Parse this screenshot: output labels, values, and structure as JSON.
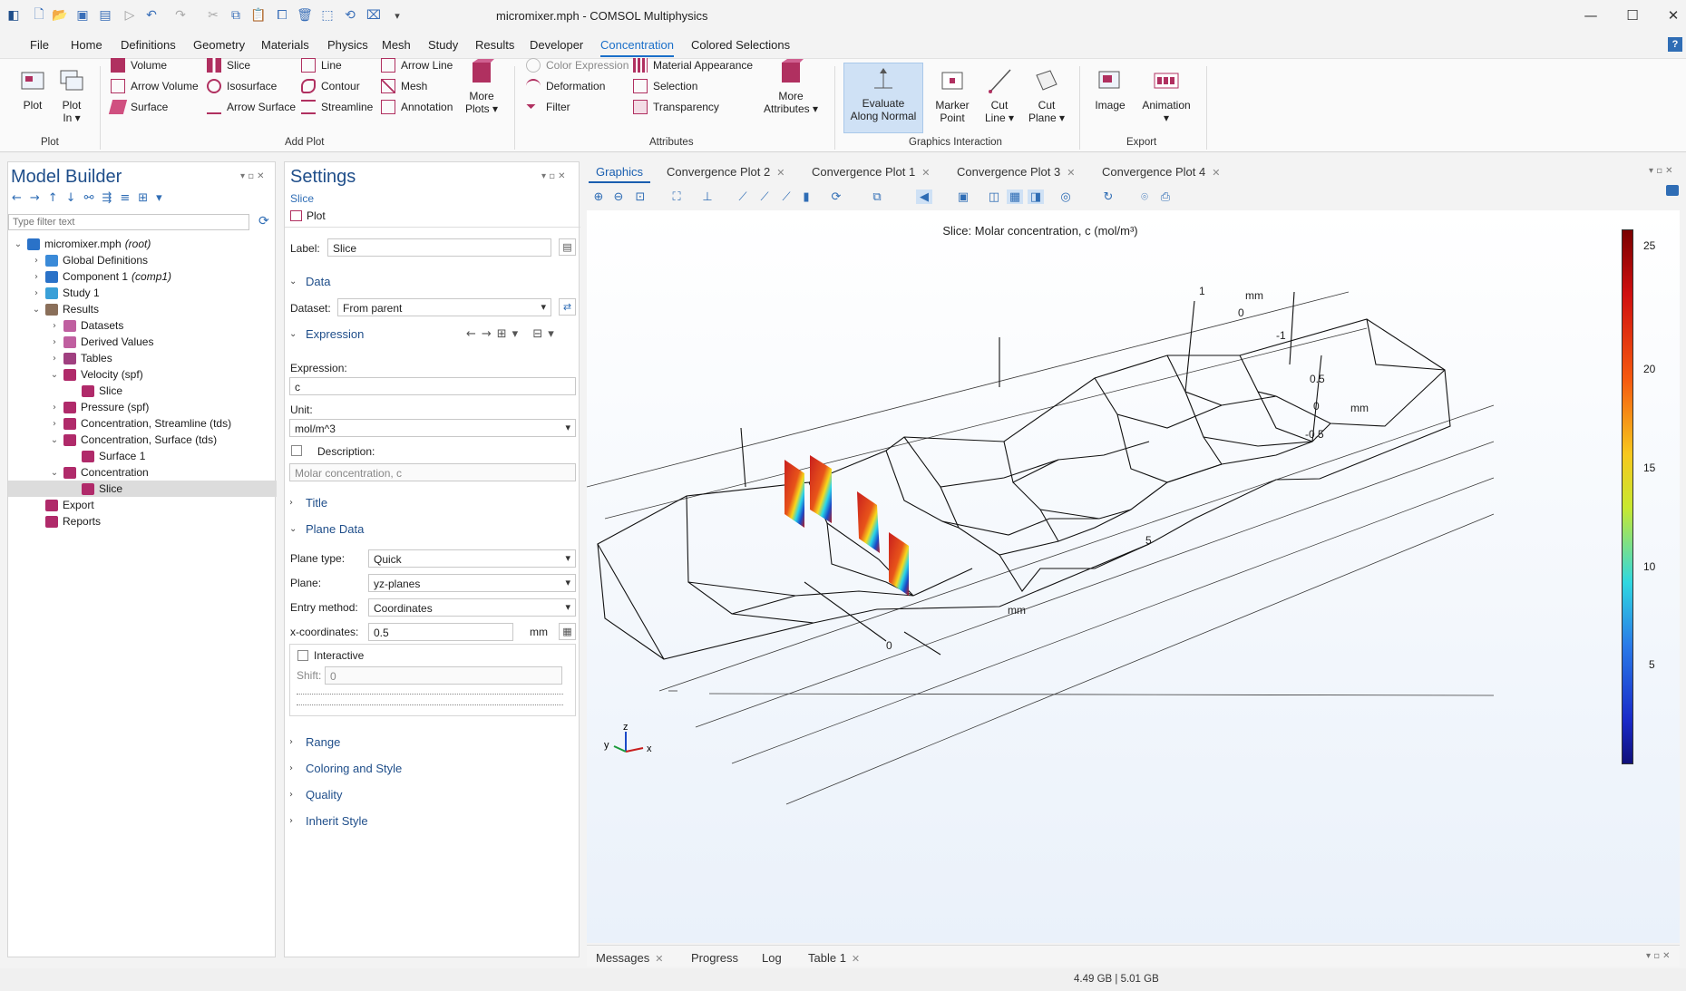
{
  "window": {
    "title": "micromixer.mph - COMSOL Multiphysics"
  },
  "menu": [
    "File",
    "Home",
    "Definitions",
    "Geometry",
    "Materials",
    "Physics",
    "Mesh",
    "Study",
    "Results",
    "Developer",
    "Concentration",
    "Colored Selections"
  ],
  "ribbon": {
    "plot": {
      "plot": "Plot",
      "plot_in": "Plot\nIn ▾",
      "group": "Plot"
    },
    "add_plot": {
      "volume": "Volume",
      "arrow_volume": "Arrow Volume",
      "surface": "Surface",
      "slice": "Slice",
      "isosurface": "Isosurface",
      "arrow_surface": "Arrow Surface",
      "line": "Line",
      "contour": "Contour",
      "streamline": "Streamline",
      "arrow_line": "Arrow Line",
      "mesh": "Mesh",
      "annotation": "Annotation",
      "more_plots": "More\nPlots ▾",
      "group": "Add Plot"
    },
    "attributes": {
      "color_expression": "Color Expression",
      "deformation": "Deformation",
      "filter": "Filter",
      "material_appearance": "Material Appearance",
      "selection": "Selection",
      "transparency": "Transparency",
      "more_attributes": "More\nAttributes ▾",
      "group": "Attributes"
    },
    "graphics_interaction": {
      "evaluate": "Evaluate\nAlong Normal",
      "marker": "Marker\nPoint",
      "cut_line": "Cut\nLine ▾",
      "cut_plane": "Cut\nPlane ▾",
      "group": "Graphics Interaction"
    },
    "export": {
      "image": "Image",
      "animation": "Animation\n▾",
      "group": "Export"
    }
  },
  "model_builder": {
    "title": "Model Builder",
    "filter_placeholder": "Type filter text",
    "tree": [
      {
        "label": "micromixer.mph",
        "suffix": "(root)",
        "level": 0,
        "exp": "v",
        "color": "#2a72c8"
      },
      {
        "label": "Global Definitions",
        "suffix": "",
        "level": 1,
        "exp": ">",
        "color": "#3a8ad8"
      },
      {
        "label": "Component 1",
        "suffix": "(comp1)",
        "level": 1,
        "exp": ">",
        "color": "#2a72c8"
      },
      {
        "label": "Study 1",
        "suffix": "",
        "level": 1,
        "exp": ">",
        "color": "#3aa0d8"
      },
      {
        "label": "Results",
        "suffix": "",
        "level": 1,
        "exp": "v",
        "color": "#8a6f5a"
      },
      {
        "label": "Datasets",
        "suffix": "",
        "level": 2,
        "exp": ">",
        "color": "#c05fa0"
      },
      {
        "label": "Derived Values",
        "suffix": "",
        "level": 2,
        "exp": ">",
        "color": "#c05fa0"
      },
      {
        "label": "Tables",
        "suffix": "",
        "level": 2,
        "exp": ">",
        "color": "#a04080"
      },
      {
        "label": "Velocity (spf)",
        "suffix": "",
        "level": 2,
        "exp": "v",
        "color": "#b02a6a"
      },
      {
        "label": "Slice",
        "suffix": "",
        "level": 3,
        "exp": "",
        "color": "#b02a6a"
      },
      {
        "label": "Pressure (spf)",
        "suffix": "",
        "level": 2,
        "exp": ">",
        "color": "#b02a6a"
      },
      {
        "label": "Concentration, Streamline (tds)",
        "suffix": "",
        "level": 2,
        "exp": ">",
        "color": "#b02a6a"
      },
      {
        "label": "Concentration, Surface (tds)",
        "suffix": "",
        "level": 2,
        "exp": "v",
        "color": "#b02a6a"
      },
      {
        "label": "Surface 1",
        "suffix": "",
        "level": 3,
        "exp": "",
        "color": "#b02a6a"
      },
      {
        "label": "Concentration",
        "suffix": "",
        "level": 2,
        "exp": "v",
        "color": "#b02a6a"
      },
      {
        "label": "Slice",
        "suffix": "",
        "level": 3,
        "exp": "",
        "color": "#b02a6a",
        "selected": true
      },
      {
        "label": "Export",
        "suffix": "",
        "level": 1,
        "exp": "",
        "color": "#b02a6a"
      },
      {
        "label": "Reports",
        "suffix": "",
        "level": 1,
        "exp": "",
        "color": "#b02a6a"
      }
    ]
  },
  "settings": {
    "title": "Settings",
    "subtitle": "Slice",
    "plot_btn": "Plot",
    "label_caption": "Label:",
    "label_value": "Slice",
    "sections": {
      "data": "Data",
      "expression": "Expression",
      "title": "Title",
      "plane_data": "Plane Data",
      "range": "Range",
      "coloring": "Coloring and Style",
      "quality": "Quality",
      "inherit": "Inherit Style"
    },
    "dataset_caption": "Dataset:",
    "dataset_value": "From parent",
    "expression_caption": "Expression:",
    "expression_value": "c",
    "unit_caption": "Unit:",
    "unit_value": "mol/m^3",
    "description_caption": "Description:",
    "description_value": "Molar concentration, c",
    "plane_type_caption": "Plane type:",
    "plane_type_value": "Quick",
    "plane_caption": "Plane:",
    "plane_value": "yz-planes",
    "entry_caption": "Entry method:",
    "entry_value": "Coordinates",
    "xcoord_caption": "x-coordinates:",
    "xcoord_value": "0.5",
    "xcoord_unit": "mm",
    "interactive_caption": "Interactive",
    "shift_caption": "Shift:",
    "shift_value": "0"
  },
  "graphics": {
    "tabs": [
      "Graphics",
      "Convergence Plot 2",
      "Convergence Plot 1",
      "Convergence Plot 3",
      "Convergence Plot 4"
    ],
    "plot_title": "Slice: Molar concentration, c (mol/m³)",
    "colorbar_ticks": [
      "25",
      "20",
      "15",
      "10",
      "5"
    ],
    "axis_labels": {
      "x_axis": {
        "ticks": [
          "0",
          "5"
        ],
        "unit": "mm"
      },
      "y_axis": {
        "ticks": [
          "1",
          "0",
          "-1"
        ],
        "unit": "mm"
      },
      "z_axis": {
        "ticks": [
          "0.5",
          "0",
          "-0.5"
        ],
        "unit": "mm"
      }
    },
    "triad": {
      "x": "x",
      "y": "y",
      "z": "z"
    }
  },
  "bottom_tabs": [
    "Messages",
    "Progress",
    "Log",
    "Table 1"
  ],
  "status": "4.49 GB | 5.01 GB"
}
